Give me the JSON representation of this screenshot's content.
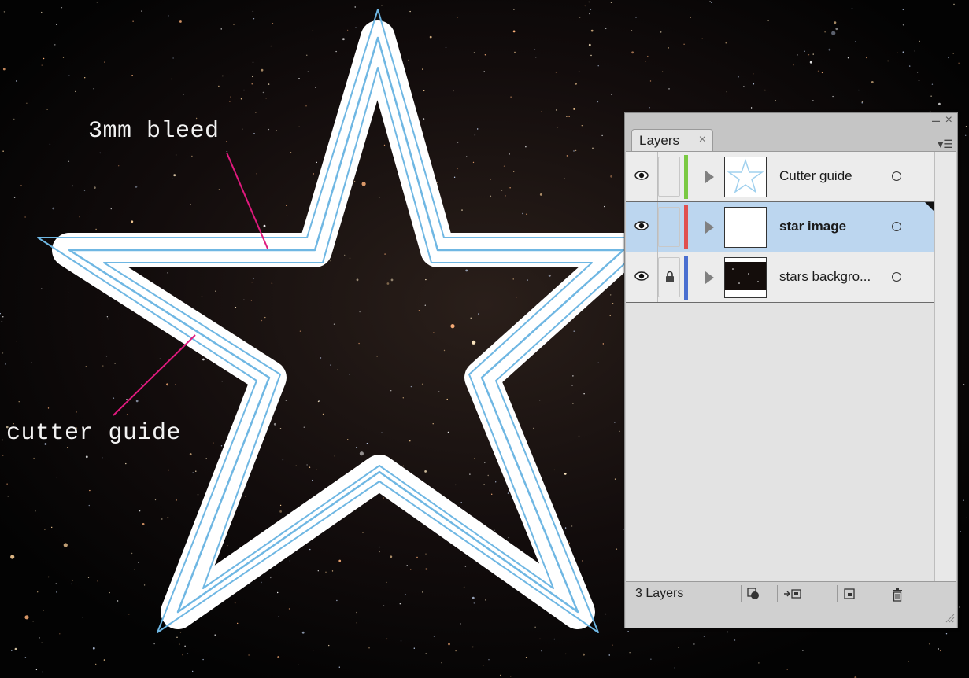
{
  "annotations": {
    "bleed": "3mm bleed",
    "cutter": "cutter guide"
  },
  "colors": {
    "leader_line": "#e0197d",
    "guide_line": "#6fb7e3",
    "bleed_fill": "#ffffff"
  },
  "layers_panel": {
    "tab_label": "Layers",
    "tab_close_icon": "close-icon",
    "menu_icon": "panel-menu-icon",
    "layers": [
      {
        "name": "Cutter guide",
        "visible": true,
        "locked": false,
        "color": "#7ac943",
        "selected": false,
        "thumb": "star-outline"
      },
      {
        "name": "star image",
        "visible": true,
        "locked": false,
        "color": "#e05050",
        "selected": true,
        "thumb": "white"
      },
      {
        "name": "stars backgro...",
        "visible": true,
        "locked": true,
        "color": "#4a6fd0",
        "selected": false,
        "thumb": "starfield"
      }
    ],
    "footer": {
      "count_label": "3 Layers"
    }
  }
}
